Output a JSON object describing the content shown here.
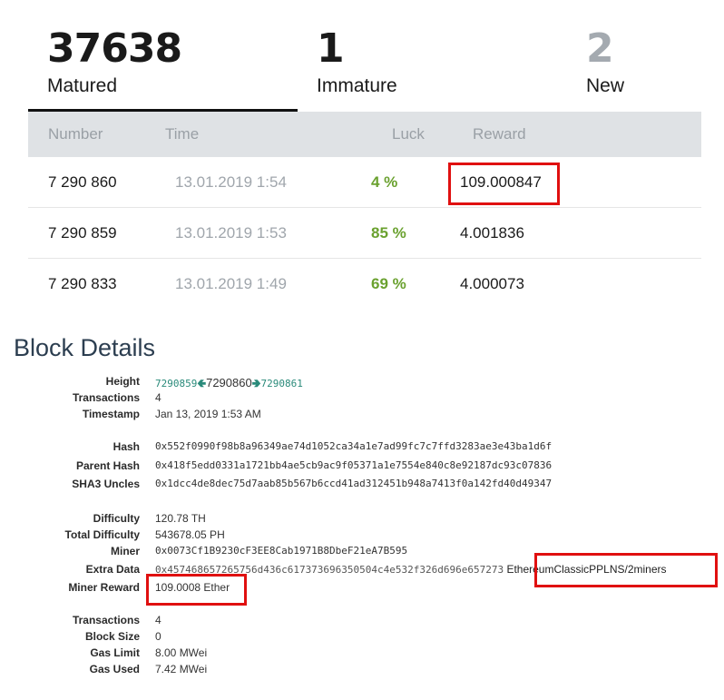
{
  "pool": {
    "counters": [
      {
        "value": "37638",
        "label": "Matured"
      },
      {
        "value": "1",
        "label": "Immature"
      },
      {
        "value": "2",
        "label": "New"
      }
    ],
    "table": {
      "headers": {
        "number": "Number",
        "time": "Time",
        "luck": "Luck",
        "reward": "Reward"
      },
      "rows": [
        {
          "number": "7 290 860",
          "time": "13.01.2019 1:54",
          "luck": "4 %",
          "reward": "109.000847"
        },
        {
          "number": "7 290 859",
          "time": "13.01.2019 1:53",
          "luck": "85 %",
          "reward": "4.001836"
        },
        {
          "number": "7 290 833",
          "time": "13.01.2019 1:49",
          "luck": "69 %",
          "reward": "4.000073"
        }
      ]
    },
    "colors": {
      "luck_green": "#6aa12f",
      "highlight_red": "#e01010"
    }
  },
  "details": {
    "title": "Block Details",
    "height": {
      "label": "Height",
      "prev": "7290859",
      "current": "7290860",
      "next": "7290861"
    },
    "transactions": {
      "label": "Transactions",
      "value": "4"
    },
    "timestamp": {
      "label": "Timestamp",
      "value": "Jan 13, 2019 1:53 AM"
    },
    "hash": {
      "label": "Hash",
      "value": "0x552f0990f98b8a96349ae74d1052ca34a1e7ad99fc7c7ffd3283ae3e43ba1d6f"
    },
    "parent_hash": {
      "label": "Parent Hash",
      "value": "0x418f5edd0331a1721bb4ae5cb9ac9f05371a1e7554e840c8e92187dc93c07836"
    },
    "sha3_uncles": {
      "label": "SHA3 Uncles",
      "value": "0x1dcc4de8dec75d7aab85b567b6ccd41ad312451b948a7413f0a142fd40d49347"
    },
    "difficulty": {
      "label": "Difficulty",
      "value": "120.78 TH"
    },
    "total_difficulty": {
      "label": "Total Difficulty",
      "value": "543678.05 PH"
    },
    "miner": {
      "label": "Miner",
      "value": "0x0073Cf1B9230cF3EE8Cab1971B8DbeF21eA7B595"
    },
    "extra_data": {
      "label": "Extra Data",
      "value": "0x457468657265756d436c617373696350504c4e532f326d696e657273",
      "decoded": "EthereumClassicPPLNS/2miners"
    },
    "miner_reward": {
      "label": "Miner Reward",
      "value": "109.0008 Ether"
    },
    "transactions2": {
      "label": "Transactions",
      "value": "4"
    },
    "block_size": {
      "label": "Block Size",
      "value": "0"
    },
    "gas_limit": {
      "label": "Gas Limit",
      "value": "8.00 MWei"
    },
    "gas_used": {
      "label": "Gas Used",
      "value": "7.42 MWei"
    }
  }
}
